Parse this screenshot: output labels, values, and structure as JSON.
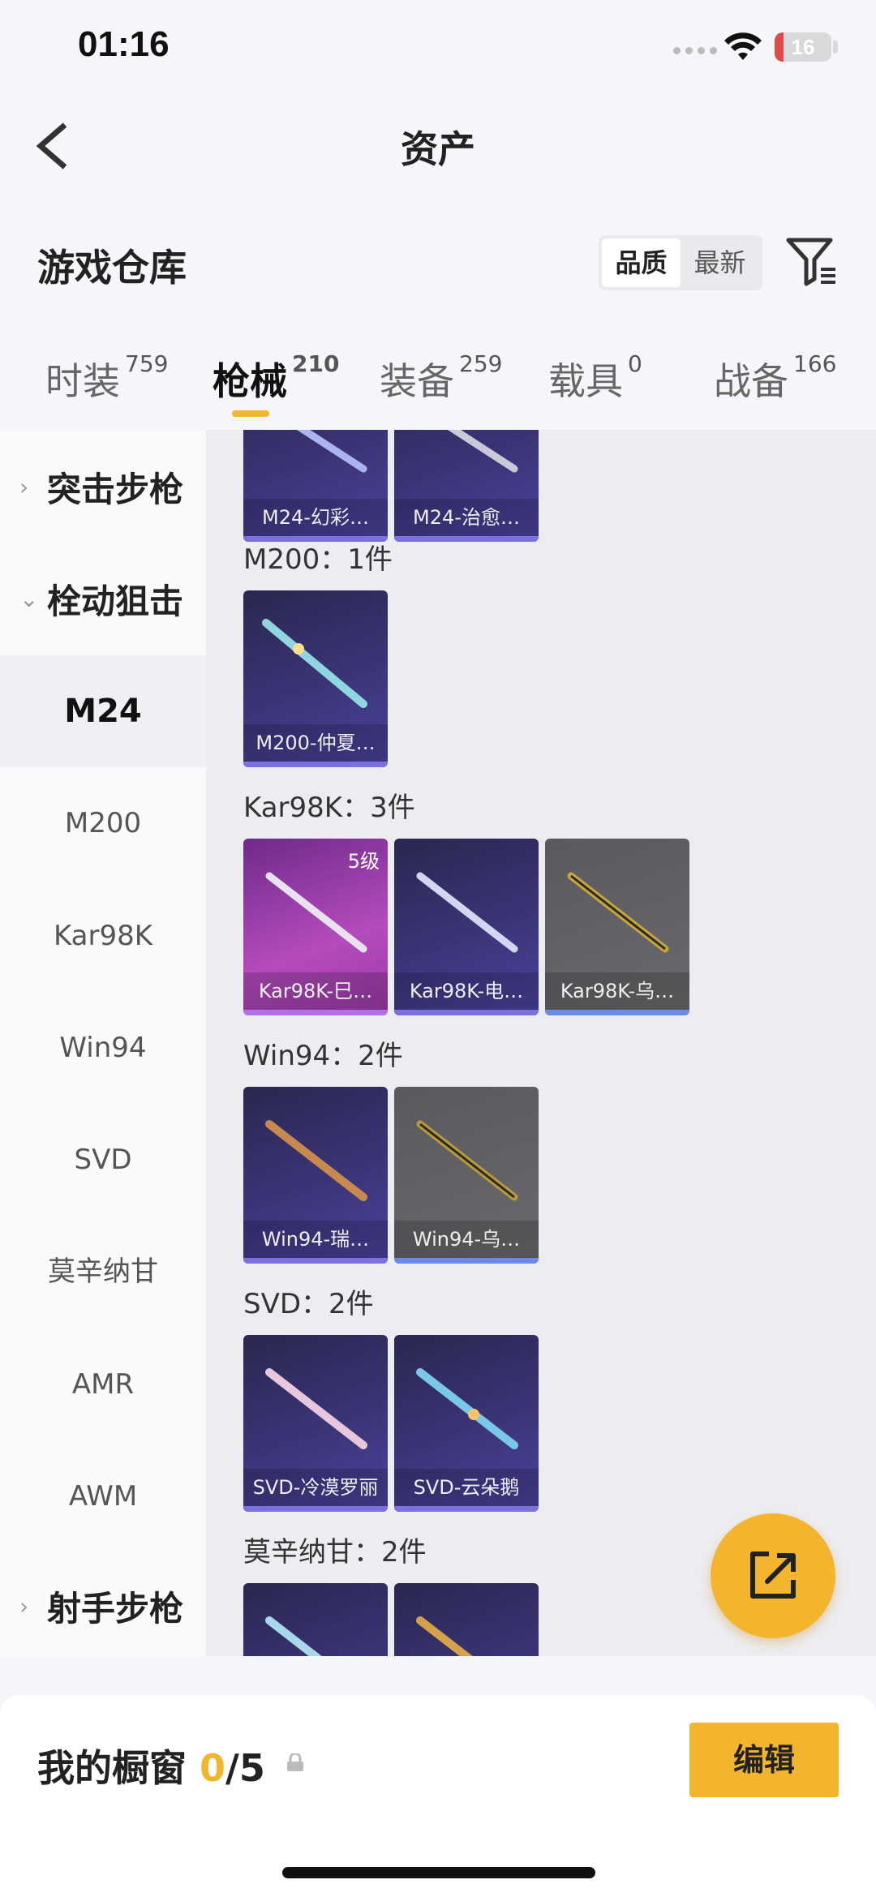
{
  "status_bar": {
    "time": "01:16",
    "battery": "16",
    "battery_level": 0.16
  },
  "nav": {
    "title": "资产"
  },
  "section": {
    "title": "游戏仓库",
    "sort_options": [
      "品质",
      "最新"
    ],
    "active_sort": "品质"
  },
  "tabs": [
    {
      "label": "时装",
      "count": "759"
    },
    {
      "label": "枪械",
      "count": "210",
      "active": true
    },
    {
      "label": "装备",
      "count": "259"
    },
    {
      "label": "载具",
      "count": "0"
    },
    {
      "label": "战备",
      "count": "166"
    }
  ],
  "sidebar": {
    "groups": [
      "突击步枪",
      "栓动狙击",
      "射手步枪"
    ],
    "items": [
      "M24",
      "M200",
      "Kar98K",
      "Win94",
      "SVD",
      "莫辛纳甘",
      "AMR",
      "AWM"
    ],
    "active_item": "M24"
  },
  "content": {
    "groups": [
      {
        "label": "",
        "items": [
          "M24-幻彩…",
          "M24-治愈…"
        ]
      },
      {
        "label": "M200：1件",
        "items": [
          "M200-仲夏…"
        ]
      },
      {
        "label": "Kar98K：3件",
        "items": [
          "Kar98K-巳…",
          "Kar98K-电…",
          "Kar98K-乌…"
        ],
        "level_badge": "5级"
      },
      {
        "label": "Win94：2件",
        "items": [
          "Win94-瑞…",
          "Win94-乌…"
        ]
      },
      {
        "label": "SVD：2件",
        "items": [
          "SVD-冷漠罗丽",
          "SVD-云朵鹅"
        ]
      },
      {
        "label": "莫辛纳甘：2件",
        "items": [
          "",
          ""
        ]
      }
    ]
  },
  "footer": {
    "showcase_label": "我的橱窗",
    "showcase_count": "0",
    "showcase_total": "/5",
    "edit_label": "编辑"
  },
  "colors": {
    "accent": "#f3b52e",
    "card_purple": "#3b3578",
    "card_pink": "#b54bbd",
    "card_gray": "#6a6a6e"
  }
}
